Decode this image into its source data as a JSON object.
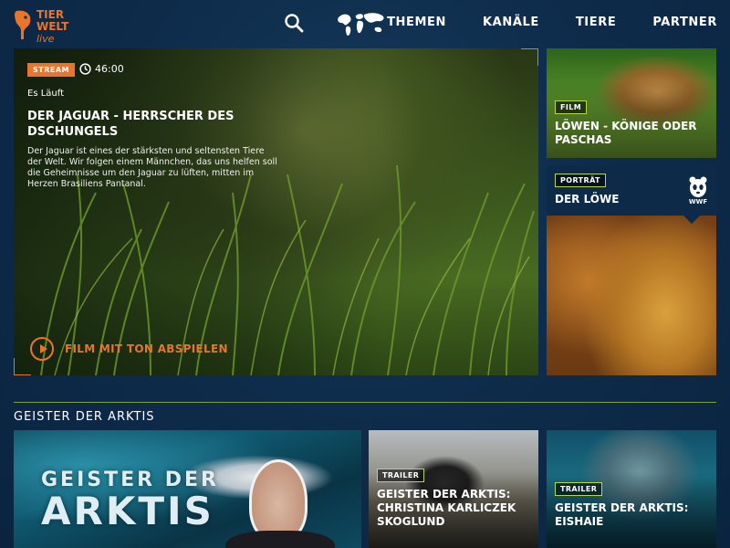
{
  "logo": {
    "line1": "TIER",
    "line2": "WELT",
    "line3": "live",
    "accent": "#e8752a"
  },
  "header": {
    "search_icon": "search-icon",
    "map_icon": "world-map-icon",
    "nav": [
      "THEMEN",
      "KANÄLE",
      "TIERE",
      "PARTNER"
    ]
  },
  "hero": {
    "badge": "STREAM",
    "clock_icon": "clock-icon",
    "duration": "46:00",
    "status": "Es Läuft",
    "title": "DER JAGUAR - HERRSCHER DES DSCHUNGELS",
    "description": "Der Jaguar ist eines der stärksten und seltensten Tiere der Welt. Wir folgen einem Männchen, das uns helfen soll die Geheimnisse um den Jaguar zu lüften, mitten im Herzen Brasiliens Pantanal.",
    "cta_label": "FILM MIT TON ABSPIELEN",
    "cta_icon": "play-circle-icon"
  },
  "side_cards": [
    {
      "badge": "FILM",
      "title": "LÖWEN - KÖNIGE ODER PASCHAS"
    },
    {
      "badge": "PORTRÄT",
      "title": "DER LÖWE",
      "partner_logo": "WWF"
    }
  ],
  "section": {
    "title": "GEISTER DER ARKTIS",
    "cards": [
      {
        "overlay_line1": "GEISTER DER",
        "overlay_line2": "ARKTIS"
      },
      {
        "badge": "TRAILER",
        "title": "GEISTER DER ARKTIS: CHRISTINA KARLICZEK SKOGLUND"
      },
      {
        "badge": "TRAILER",
        "title": "GEISTER DER ARKTIS: EISHAIE"
      }
    ]
  },
  "colors": {
    "accent": "#e8752a",
    "badge_border": "#b7d84b",
    "background": "#0e2c4b",
    "divider": "#7fa33a"
  }
}
